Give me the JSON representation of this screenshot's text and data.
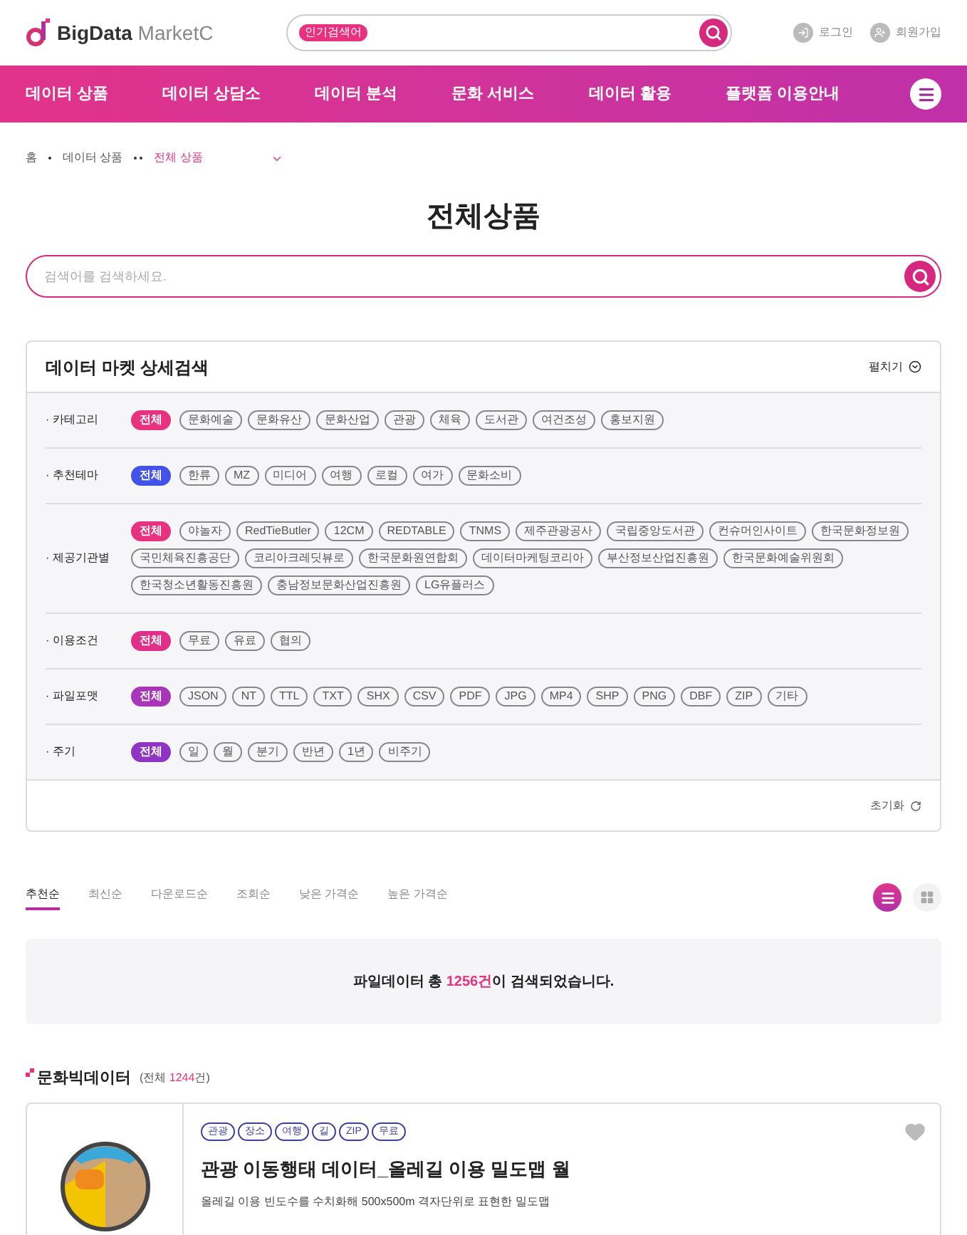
{
  "header": {
    "logo": {
      "brand": "BigData",
      "suffix": "MarketC"
    },
    "search": {
      "badge": "인기검색어"
    },
    "links": [
      {
        "kind": "login",
        "label": "로그인"
      },
      {
        "kind": "join",
        "label": "회원가입"
      }
    ]
  },
  "nav": {
    "items": [
      "데이터 상품",
      "데이터 상담소",
      "데이터 분석",
      "문화 서비스",
      "데이터 활용",
      "플랫폼 이용안내"
    ]
  },
  "breadcrumb": [
    "홈",
    "데이터 상품",
    "전체 상품"
  ],
  "page_title": "전체상품",
  "search": {
    "placeholder": "검색어를 검색하세요."
  },
  "filter_panel": {
    "title": "데이터 마켓 상세검색",
    "toggle": "펼치기",
    "reset": "초기화",
    "groups": [
      {
        "label": "· 카테고리",
        "color": "#e8327f",
        "options": [
          {
            "label": "전체",
            "selected": true
          },
          {
            "label": "문화예술",
            "selected": false
          },
          {
            "label": "문화유산",
            "selected": false
          },
          {
            "label": "문화산업",
            "selected": false
          },
          {
            "label": "관광",
            "selected": false
          },
          {
            "label": "체육",
            "selected": false
          },
          {
            "label": "도서관",
            "selected": false
          },
          {
            "label": "여건조성",
            "selected": false
          },
          {
            "label": "홍보지원",
            "selected": false
          }
        ]
      },
      {
        "label": "· 추천테마",
        "color": "#4353e8",
        "options": [
          {
            "label": "전체",
            "selected": true
          },
          {
            "label": "한류",
            "selected": false
          },
          {
            "label": "MZ",
            "selected": false
          },
          {
            "label": "미디어",
            "selected": false
          },
          {
            "label": "여행",
            "selected": false
          },
          {
            "label": "로컬",
            "selected": false
          },
          {
            "label": "여가",
            "selected": false
          },
          {
            "label": "문화소비",
            "selected": false
          }
        ]
      },
      {
        "label": "· 제공기관별",
        "color": "#e8327f",
        "options": [
          {
            "label": "전체",
            "selected": true
          },
          {
            "label": "야놀자",
            "selected": false
          },
          {
            "label": "RedTieButler",
            "selected": false
          },
          {
            "label": "12CM",
            "selected": false
          },
          {
            "label": "REDTABLE",
            "selected": false
          },
          {
            "label": "TNMS",
            "selected": false
          },
          {
            "label": "제주관광공사",
            "selected": false
          },
          {
            "label": "국립중앙도서관",
            "selected": false
          },
          {
            "label": "컨슈머인사이트",
            "selected": false
          },
          {
            "label": "한국문화정보원",
            "selected": false
          },
          {
            "label": "국민체육진흥공단",
            "selected": false
          },
          {
            "label": "코리아크레딧뷰로",
            "selected": false
          },
          {
            "label": "한국문화원연합회",
            "selected": false
          },
          {
            "label": "데이터마케팅코리아",
            "selected": false
          },
          {
            "label": "부산정보산업진흥원",
            "selected": false
          },
          {
            "label": "한국문화예술위원회",
            "selected": false
          },
          {
            "label": "한국청소년활동진흥원",
            "selected": false
          },
          {
            "label": "충남정보문화산업진흥원",
            "selected": false
          },
          {
            "label": "LG유플러스",
            "selected": false
          }
        ]
      },
      {
        "label": "· 이용조건",
        "color": "#e0308a",
        "options": [
          {
            "label": "전체",
            "selected": true
          },
          {
            "label": "무료",
            "selected": false
          },
          {
            "label": "유료",
            "selected": false
          },
          {
            "label": "협의",
            "selected": false
          }
        ]
      },
      {
        "label": "· 파일포맷",
        "color": "#a936b8",
        "options": [
          {
            "label": "전체",
            "selected": true
          },
          {
            "label": "JSON",
            "selected": false
          },
          {
            "label": "NT",
            "selected": false
          },
          {
            "label": "TTL",
            "selected": false
          },
          {
            "label": "TXT",
            "selected": false
          },
          {
            "label": "SHX",
            "selected": false
          },
          {
            "label": "CSV",
            "selected": false
          },
          {
            "label": "PDF",
            "selected": false
          },
          {
            "label": "JPG",
            "selected": false
          },
          {
            "label": "MP4",
            "selected": false
          },
          {
            "label": "SHP",
            "selected": false
          },
          {
            "label": "PNG",
            "selected": false
          },
          {
            "label": "DBF",
            "selected": false
          },
          {
            "label": "ZIP",
            "selected": false
          },
          {
            "label": "기타",
            "selected": false
          }
        ]
      },
      {
        "label": "· 주기",
        "color": "#8e35c4",
        "options": [
          {
            "label": "전체",
            "selected": true
          },
          {
            "label": "일",
            "selected": false
          },
          {
            "label": "월",
            "selected": false
          },
          {
            "label": "분기",
            "selected": false
          },
          {
            "label": "반년",
            "selected": false
          },
          {
            "label": "1년",
            "selected": false
          },
          {
            "label": "비주기",
            "selected": false
          }
        ]
      }
    ]
  },
  "sort_tabs": [
    {
      "label": "추천순",
      "selected": true
    },
    {
      "label": "최신순",
      "selected": false
    },
    {
      "label": "다운로드순",
      "selected": false
    },
    {
      "label": "조회순",
      "selected": false
    },
    {
      "label": "낮은 가격순",
      "selected": false
    },
    {
      "label": "높은 가격순",
      "selected": false
    }
  ],
  "view_modes": [
    {
      "kind": "list",
      "selected": true
    },
    {
      "kind": "grid",
      "selected": false
    }
  ],
  "result": {
    "before": "파일데이터 총 ",
    "count": "1256건",
    "after": "이 검색되었습니다."
  },
  "section": {
    "title": "문화빅데이터",
    "before": "(전체 ",
    "count": "1244",
    "after": "건)"
  },
  "cards": [
    {
      "tags": [
        "관광",
        "장소",
        "여행",
        "길",
        "ZIP",
        "무료"
      ],
      "title": "관광 이동행태 데이터_올레길 이용 밀도맵 월",
      "description": "올레길 이용 빈도수를 수치화해 500x500m 격자단위로 표현한 밀도맵",
      "favorite": false
    }
  ]
}
